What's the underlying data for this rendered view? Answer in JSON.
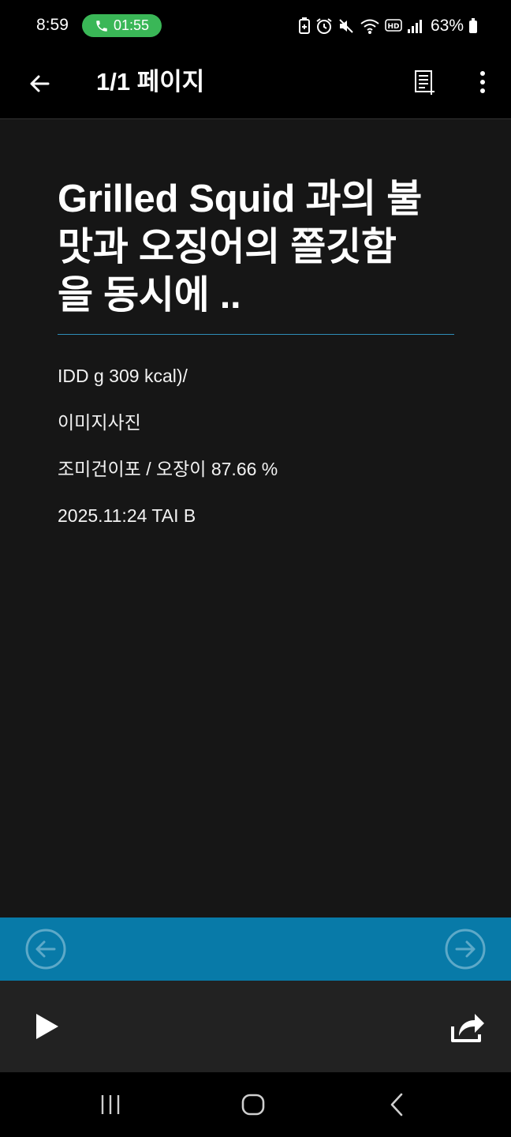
{
  "status_bar": {
    "time": "8:59",
    "call_timer": "01:55",
    "battery_percent": "63%",
    "icons": [
      "battery-saver-icon",
      "alarm-icon",
      "mute-icon",
      "wifi-icon",
      "hd-icon",
      "signal-icon",
      "battery-icon"
    ]
  },
  "app_bar": {
    "title": "1/1 페이지",
    "icons": [
      "back-arrow-icon",
      "list-add-icon",
      "more-vertical-icon"
    ]
  },
  "article": {
    "headline_lines": [
      "Grilled Squid 과의 불",
      "맛과 오징어의 쫄깃함",
      "을 동시에 .."
    ],
    "lines": [
      "IDD g 309 kcal)/",
      "이미지사진",
      "조미건이포 / 오장이 87.66 %",
      "2025.11:24 TAI B"
    ]
  },
  "page_nav": {
    "icons": [
      "circle-arrow-left-icon",
      "circle-arrow-right-icon"
    ]
  },
  "player": {
    "icons": [
      "play-icon",
      "share-icon"
    ]
  },
  "system_nav": {
    "icons": [
      "recent-apps-icon",
      "home-icon",
      "back-icon"
    ]
  },
  "colors": {
    "background": "#161616",
    "bar_background": "#000000",
    "divider_accent": "#2e8db8",
    "nav_strip": "#087aa8",
    "player_bar": "#222222",
    "call_pill": "#3ab757"
  }
}
